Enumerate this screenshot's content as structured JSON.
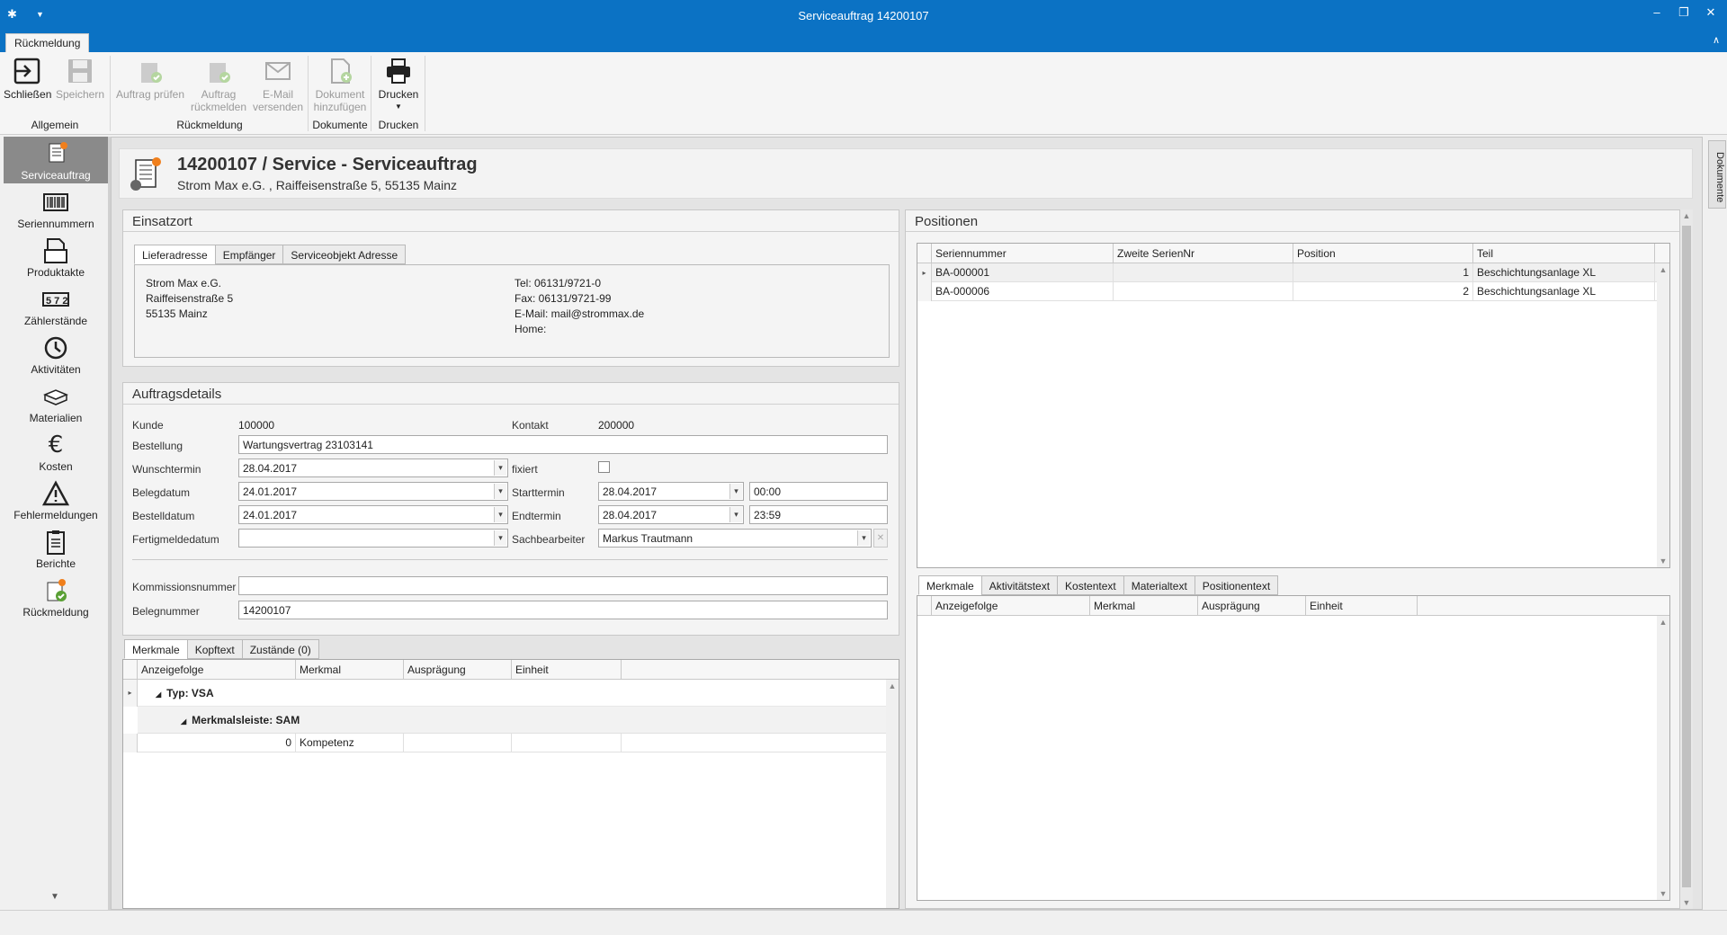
{
  "window": {
    "title": "Serviceauftrag 14200107"
  },
  "ribbon": {
    "tab": "Rückmeldung",
    "buttons": {
      "close": "Schließen",
      "save": "Speichern",
      "check": [
        "Auftrag prüfen"
      ],
      "report": [
        "Auftrag",
        "rückmelden"
      ],
      "email": [
        "E-Mail",
        "versenden"
      ],
      "adddoc": [
        "Dokument",
        "hinzufügen"
      ],
      "print": "Drucken"
    },
    "groups": {
      "general": "Allgemein",
      "feedback": "Rückmeldung",
      "documents": "Dokumente",
      "print": "Drucken"
    }
  },
  "nav": {
    "items": [
      {
        "label": "Serviceauftrag",
        "icon": "service-order-icon",
        "active": true
      },
      {
        "label": "Seriennummern",
        "icon": "barcode-icon"
      },
      {
        "label": "Produktakte",
        "icon": "folder-icon"
      },
      {
        "label": "Zählerstände",
        "icon": "counter-icon"
      },
      {
        "label": "Aktivitäten",
        "icon": "clock-icon"
      },
      {
        "label": "Materialien",
        "icon": "material-icon"
      },
      {
        "label": "Kosten",
        "icon": "euro-icon"
      },
      {
        "label": "Fehlermeldungen",
        "icon": "warning-icon"
      },
      {
        "label": "Berichte",
        "icon": "clipboard-icon"
      },
      {
        "label": "Rückmeldung",
        "icon": "feedback-icon"
      }
    ]
  },
  "dock": {
    "documents_tab": "Dokumente"
  },
  "header": {
    "title": "14200107 / Service - Serviceauftrag",
    "subtitle": "Strom Max e.G. , Raiffeisenstraße 5, 55135 Mainz"
  },
  "einsatzort": {
    "title": "Einsatzort",
    "tabs": [
      "Lieferadresse",
      "Empfänger",
      "Serviceobjekt Adresse"
    ],
    "address": [
      "Strom Max e.G.",
      "Raiffeisenstraße 5",
      "55135 Mainz"
    ],
    "contact": [
      "Tel: 06131/9721-0",
      "Fax: 06131/9721-99",
      "E-Mail: mail@strommax.de",
      "Home:"
    ]
  },
  "details": {
    "title": "Auftragsdetails",
    "kunde_label": "Kunde",
    "kunde": "100000",
    "kontakt_label": "Kontakt",
    "kontakt": "200000",
    "bestellung_label": "Bestellung",
    "bestellung": "Wartungsvertrag 23103141",
    "wunschtermin_label": "Wunschtermin",
    "wunschtermin": "28.04.2017",
    "fixiert_label": "fixiert",
    "belegdatum_label": "Belegdatum",
    "belegdatum": "24.01.2017",
    "starttermin_label": "Starttermin",
    "starttermin": "28.04.2017",
    "startzeit": "00:00",
    "bestelldatum_label": "Bestelldatum",
    "bestelldatum": "24.01.2017",
    "endtermin_label": "Endtermin",
    "endtermin": "28.04.2017",
    "endzeit": "23:59",
    "fertigmelde_label": "Fertigmeldedatum",
    "fertigmelde": "",
    "sachbearbeiter_label": "Sachbearbeiter",
    "sachbearbeiter": "Markus Trautmann",
    "kommission_label": "Kommissionsnummer",
    "kommission": "",
    "belegnummer_label": "Belegnummer",
    "belegnummer": "14200107"
  },
  "merkmale": {
    "tabs": [
      "Merkmale",
      "Kopftext",
      "Zustände (0)"
    ],
    "columns": [
      "Anzeigefolge",
      "Merkmal",
      "Ausprägung",
      "Einheit"
    ],
    "group1": "Typ: VSA",
    "group2": "Merkmalsleiste: SAM",
    "rows": [
      {
        "anzeigefolge": "0",
        "merkmal": "Kompetenz",
        "auspraegung": "",
        "einheit": ""
      }
    ]
  },
  "positionen": {
    "title": "Positionen",
    "columns": [
      "Seriennummer",
      "Zweite SerienNr",
      "Position",
      "Teil"
    ],
    "rows": [
      {
        "serial": "BA-000001",
        "serial2": "",
        "position": "1",
        "teil": "Beschichtungsanlage XL"
      },
      {
        "serial": "BA-000006",
        "serial2": "",
        "position": "2",
        "teil": "Beschichtungsanlage XL"
      }
    ],
    "subtabs": [
      "Merkmale",
      "Aktivitätstext",
      "Kostentext",
      "Materialtext",
      "Positionentext"
    ],
    "subcolumns": [
      "Anzeigefolge",
      "Merkmal",
      "Ausprägung",
      "Einheit"
    ]
  }
}
